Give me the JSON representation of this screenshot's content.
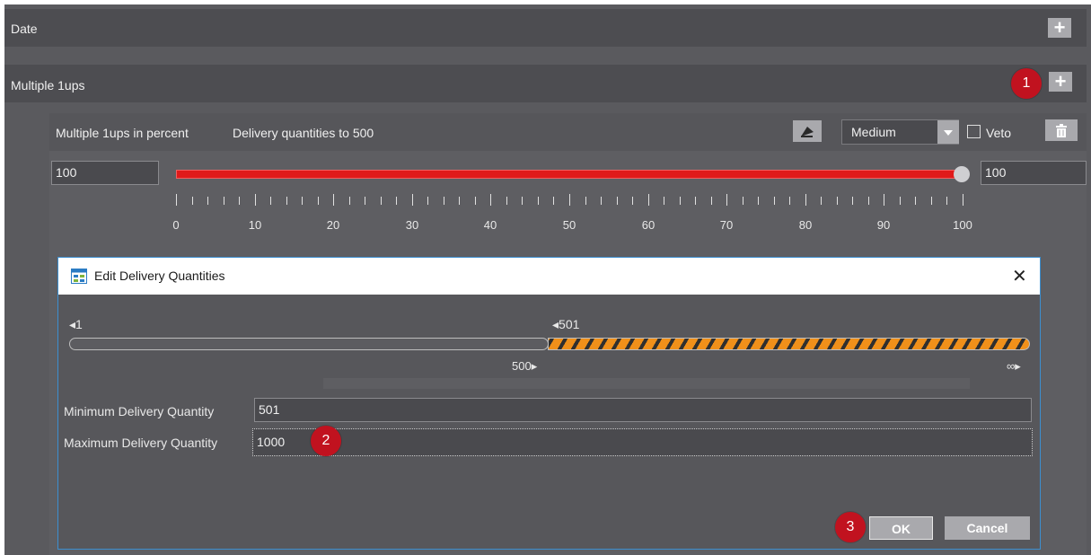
{
  "sections": {
    "date": {
      "title": "Date",
      "add_label": "+"
    },
    "multiple": {
      "title": "Multiple 1ups",
      "add_label": "+"
    }
  },
  "rule": {
    "title": "Multiple 1ups in percent",
    "subtitle": "Delivery quantities to 500",
    "priority_selected": "Medium",
    "veto_label": "Veto",
    "veto_checked": false,
    "slider_min_value": "100",
    "slider_max_value": "100",
    "slider_value_fraction": 1.0,
    "slider_fill_color": "#e01a1a",
    "scale_labels": [
      "0",
      "10",
      "20",
      "30",
      "40",
      "50",
      "60",
      "70",
      "80",
      "90",
      "100"
    ]
  },
  "dialog": {
    "title": "Edit Delivery Quantities",
    "close_label": "✕",
    "range": {
      "left_start": "◂1",
      "right_start": "◂501",
      "left_end": "500▸",
      "right_end": "∞▸"
    },
    "min_label": "Minimum Delivery Quantity",
    "min_value": "501",
    "max_label": "Maximum Delivery Quantity",
    "max_value": "1000",
    "ok_label": "OK",
    "cancel_label": "Cancel",
    "stripe_colors": [
      "#f0901a",
      "#2f2f2f"
    ]
  },
  "badges": [
    "1",
    "2",
    "3"
  ],
  "colors": {
    "panel_bg": "#5a5a5e",
    "bar_bg": "#4d4d51",
    "button_bg": "#a9a9ad",
    "badge_red": "#c1121f",
    "dialog_border": "#3c8fd0"
  }
}
